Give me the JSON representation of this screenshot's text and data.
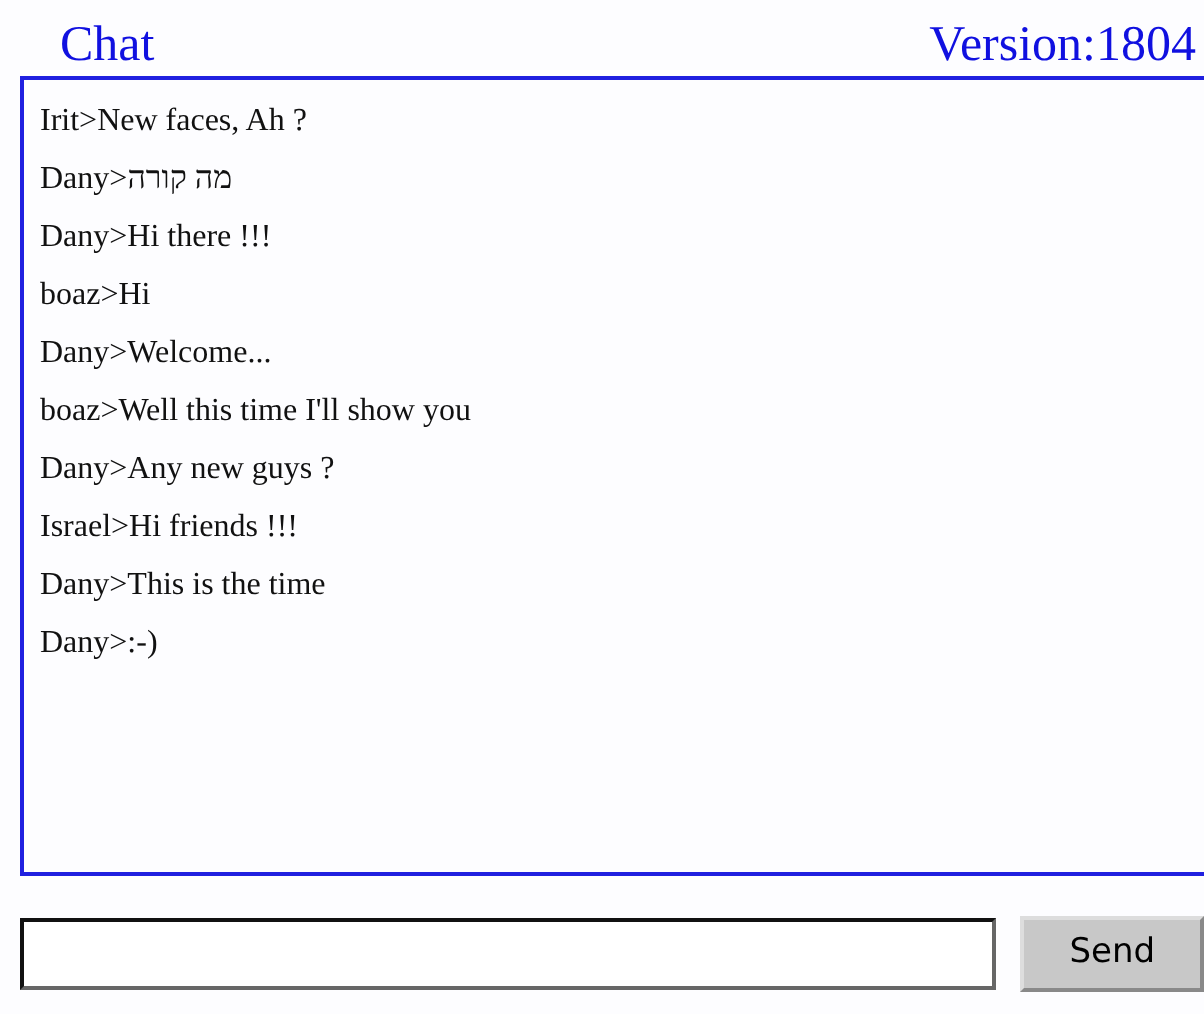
{
  "header": {
    "title": "Chat",
    "version": "Version:1804"
  },
  "messages": [
    {
      "text": "Irit>New faces, Ah ?"
    },
    {
      "text": "Dany>מה קורה"
    },
    {
      "text": "Dany>Hi there !!!"
    },
    {
      "text": "boaz>Hi"
    },
    {
      "text": "Dany>Welcome..."
    },
    {
      "text": "boaz>Well this time I'll show you"
    },
    {
      "text": "Dany>Any new guys ?"
    },
    {
      "text": "Israel>Hi friends !!!"
    },
    {
      "text": "Dany>This is the time"
    },
    {
      "text": "Dany>:-)"
    }
  ],
  "send_button": {
    "label": "Send"
  }
}
